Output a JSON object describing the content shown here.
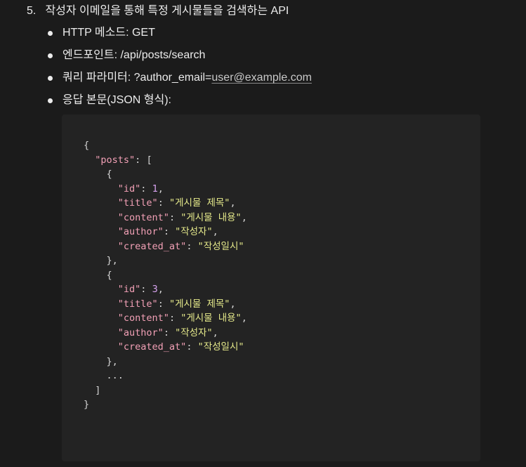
{
  "section": {
    "number": "5.",
    "title": "작성자 이메일을 통해 특정 게시물들을 검색하는 API"
  },
  "bullets": {
    "method_label": "HTTP 메소드: GET",
    "endpoint_label": "엔드포인트: /api/posts/search",
    "query_label": "쿼리 파라미터: ?author_email=",
    "query_link": "user@example.com",
    "response_label": "응답 본문(JSON 형식):"
  },
  "code": {
    "open_brace": "{",
    "posts_key": "\"posts\"",
    "open_bracket": "[",
    "items": [
      {
        "id_key": "\"id\"",
        "id": "1",
        "title_key": "\"title\"",
        "title": "\"게시물 제목\"",
        "content_key": "\"content\"",
        "content": "\"게시물 내용\"",
        "author_key": "\"author\"",
        "author": "\"작성자\"",
        "created_key": "\"created_at\"",
        "created": "\"작성일시\""
      },
      {
        "id_key": "\"id\"",
        "id": "3",
        "title_key": "\"title\"",
        "title": "\"게시물 제목\"",
        "content_key": "\"content\"",
        "content": "\"게시물 내용\"",
        "author_key": "\"author\"",
        "author": "\"작성자\"",
        "created_key": "\"created_at\"",
        "created": "\"작성일시\""
      }
    ],
    "ellipsis": "...",
    "close_bracket": "]",
    "close_brace": "}"
  },
  "colors": {
    "background": "#1b1b1b",
    "code_background": "#232323",
    "key": "#f2a0b6",
    "string": "#e4e88a",
    "number": "#d7a3ef"
  }
}
